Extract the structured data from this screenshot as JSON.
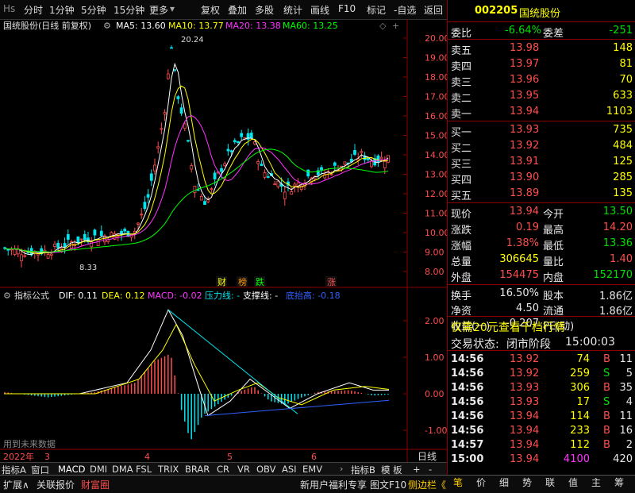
{
  "toolbar": {
    "logo": "Hs",
    "left_items": [
      "分时",
      "1分钟",
      "5分钟",
      "15分钟",
      "更多"
    ],
    "right_items": [
      "复权",
      "叠加",
      "多股",
      "统计",
      "画线",
      "F10",
      "标记",
      "-自选",
      "返回"
    ]
  },
  "main_chart": {
    "title": "国统股份(日线 前复权)",
    "ma": [
      {
        "label": "MA5: 13.60",
        "color": "#ffffff"
      },
      {
        "label": "MA10: 13.77",
        "color": "#ffff00"
      },
      {
        "label": "MA20: 13.38",
        "color": "#ff33ff"
      },
      {
        "label": "MA60: 13.25",
        "color": "#00ff00"
      }
    ],
    "yticks": [
      "20.00",
      "19.00",
      "18.00",
      "17.00",
      "16.00",
      "15.00",
      "14.00",
      "13.00",
      "12.00",
      "11.00",
      "10.00",
      "9.00",
      "8.00"
    ],
    "high_mark": "20.24",
    "low_mark": "8.33",
    "event_tags": [
      "财",
      "榜",
      "跌",
      "涨"
    ]
  },
  "sub_chart": {
    "title": "指标公式",
    "params": [
      {
        "label": "DIF: 0.11",
        "color": "#ffffff"
      },
      {
        "label": "DEA: 0.12",
        "color": "#ffff00"
      },
      {
        "label": "MACD: -0.02",
        "color": "#ff33ff"
      },
      {
        "label": "压力线: -",
        "color": "#00e5ee"
      },
      {
        "label": "支撑线: -",
        "color": "#ffffff"
      },
      {
        "label": "底抬高: -0.18",
        "color": "#3060ff"
      }
    ],
    "yticks": [
      "2.00",
      "1.00",
      "0.00",
      "-1.00"
    ],
    "warning": "用到未来数据"
  },
  "xaxis": {
    "labels": [
      "2022年",
      "3",
      "4",
      "5",
      "6"
    ],
    "unit": "日线"
  },
  "indicator_tabs": [
    "指标A",
    "窗口",
    "MACD",
    "DMI",
    "DMA",
    "FSL",
    "TRIX",
    "BRAR",
    "CR",
    "VR",
    "OBV",
    "ASI",
    "EMV"
  ],
  "indicator_tabs_right": [
    "指标B",
    "模 板",
    "+",
    "-"
  ],
  "quote": {
    "code": "002205",
    "name": "国统股份",
    "weibi_label": "委比",
    "weibi": "-6.64%",
    "weicha_label": "委差",
    "weicha": "-251",
    "sell": [
      {
        "label": "卖五",
        "price": "13.98",
        "vol": "148"
      },
      {
        "label": "卖四",
        "price": "13.97",
        "vol": "81"
      },
      {
        "label": "卖三",
        "price": "13.96",
        "vol": "70"
      },
      {
        "label": "卖二",
        "price": "13.95",
        "vol": "633"
      },
      {
        "label": "卖一",
        "price": "13.94",
        "vol": "1103"
      }
    ],
    "buy": [
      {
        "label": "买一",
        "price": "13.93",
        "vol": "735"
      },
      {
        "label": "买二",
        "price": "13.92",
        "vol": "484"
      },
      {
        "label": "买三",
        "price": "13.91",
        "vol": "125"
      },
      {
        "label": "买四",
        "price": "13.90",
        "vol": "285"
      },
      {
        "label": "买五",
        "price": "13.89",
        "vol": "135"
      }
    ],
    "stats": [
      {
        "l1": "现价",
        "v1": "13.94",
        "c1": "red",
        "l2": "今开",
        "v2": "13.50",
        "c2": "green"
      },
      {
        "l1": "涨跌",
        "v1": "0.19",
        "c1": "red",
        "l2": "最高",
        "v2": "14.20",
        "c2": "red"
      },
      {
        "l1": "涨幅",
        "v1": "1.38%",
        "c1": "red",
        "l2": "最低",
        "v2": "13.36",
        "c2": "green"
      },
      {
        "l1": "总量",
        "v1": "306645",
        "c1": "yellow",
        "l2": "量比",
        "v2": "1.40",
        "c2": "red"
      },
      {
        "l1": "外盘",
        "v1": "154475",
        "c1": "red",
        "l2": "内盘",
        "v2": "152170",
        "c2": "green"
      }
    ],
    "stats2": [
      {
        "l1": "换手",
        "v1": "16.50%",
        "l2": "股本",
        "v2": "1.86亿"
      },
      {
        "l1": "净资",
        "v1": "4.50",
        "l2": "流通",
        "v2": "1.86亿"
      },
      {
        "l1": "收益(一)",
        "v1": "-0.207",
        "l2": "PE(动)",
        "v2": ""
      }
    ],
    "promo": "仅需20元查看千档行情",
    "trade_status_label": "交易状态:",
    "trade_status": "闭市阶段",
    "trade_time": "15:00:03",
    "ticks": [
      {
        "t": "14:56",
        "p": "13.92",
        "v": "74",
        "d": "B",
        "n": "11"
      },
      {
        "t": "14:56",
        "p": "13.92",
        "v": "259",
        "d": "S",
        "n": "5"
      },
      {
        "t": "14:56",
        "p": "13.93",
        "v": "306",
        "d": "B",
        "n": "35"
      },
      {
        "t": "14:56",
        "p": "13.93",
        "v": "17",
        "d": "S",
        "n": "4"
      },
      {
        "t": "14:56",
        "p": "13.94",
        "v": "114",
        "d": "B",
        "n": "11"
      },
      {
        "t": "14:56",
        "p": "13.94",
        "v": "233",
        "d": "B",
        "n": "16"
      },
      {
        "t": "14:57",
        "p": "13.94",
        "v": "112",
        "d": "B",
        "n": "2"
      },
      {
        "t": "15:00",
        "p": "13.94",
        "v": "4100",
        "d": "",
        "n": "420"
      }
    ]
  },
  "bottombar": {
    "left": [
      "扩展∧",
      "关联报价",
      "财富圈"
    ],
    "promo": "新用户福利专享",
    "f10": "图文F10",
    "side": "侧边栏《",
    "right_icons": [
      "笔",
      "价",
      "细",
      "势",
      "联",
      "值",
      "主",
      "筹"
    ]
  },
  "colors": {
    "up": "#ff4d4d",
    "down": "#00e5ee",
    "grid": "#8b0000"
  }
}
